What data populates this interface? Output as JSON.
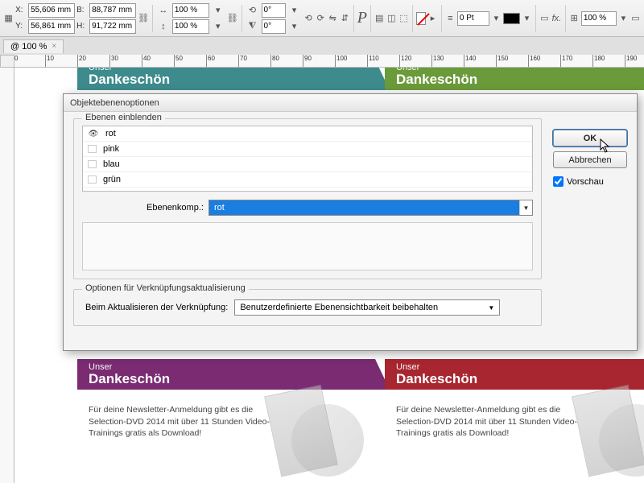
{
  "toolbar": {
    "x": "55,606 mm",
    "w": "88,787 mm",
    "y": "56,861 mm",
    "h": "91,722 mm",
    "scale_x": "100 %",
    "scale_y": "100 %",
    "rot": "0°",
    "shear": "0°",
    "stroke_pt": "0 Pt",
    "end_pct": "100 %"
  },
  "zoom_tab": {
    "label": "@ 100 %",
    "close": "×"
  },
  "ruler": {
    "ticks": [
      "0",
      "10",
      "20",
      "30",
      "40",
      "50",
      "60",
      "70",
      "80",
      "90",
      "100",
      "110",
      "120",
      "130",
      "140",
      "150",
      "160",
      "170",
      "180",
      "190"
    ]
  },
  "dialog": {
    "title": "Objektebenenoptionen",
    "group1": "Ebenen einblenden",
    "layers": [
      {
        "name": "rot",
        "visible": true
      },
      {
        "name": "pink",
        "visible": false
      },
      {
        "name": "blau",
        "visible": false
      },
      {
        "name": "grün",
        "visible": false
      }
    ],
    "combo_label": "Ebenenkomp.:",
    "combo_value": "rot",
    "group2": "Optionen für Verknüpfungsaktualisierung",
    "update_label": "Beim Aktualisieren der Verknüpfung:",
    "update_value": "Benutzerdefinierte Ebenensichtbarkeit beibehalten",
    "btn_ok": "OK",
    "btn_cancel": "Abbrechen",
    "preview": "Vorschau"
  },
  "cards": {
    "line1": "Unser",
    "line2": "Dankeschön",
    "body": "Für deine Newsletter-Anmeldung gibt es die Selection-DVD 2014 mit über 11 Stunden Video-Trainings gratis als Download!",
    "colors": {
      "teal": "#3d8b8c",
      "green": "#6a9a3a",
      "purple": "#7a2b72",
      "red": "#a8262f"
    }
  },
  "labels": {
    "B": "B:",
    "H": "H:"
  }
}
